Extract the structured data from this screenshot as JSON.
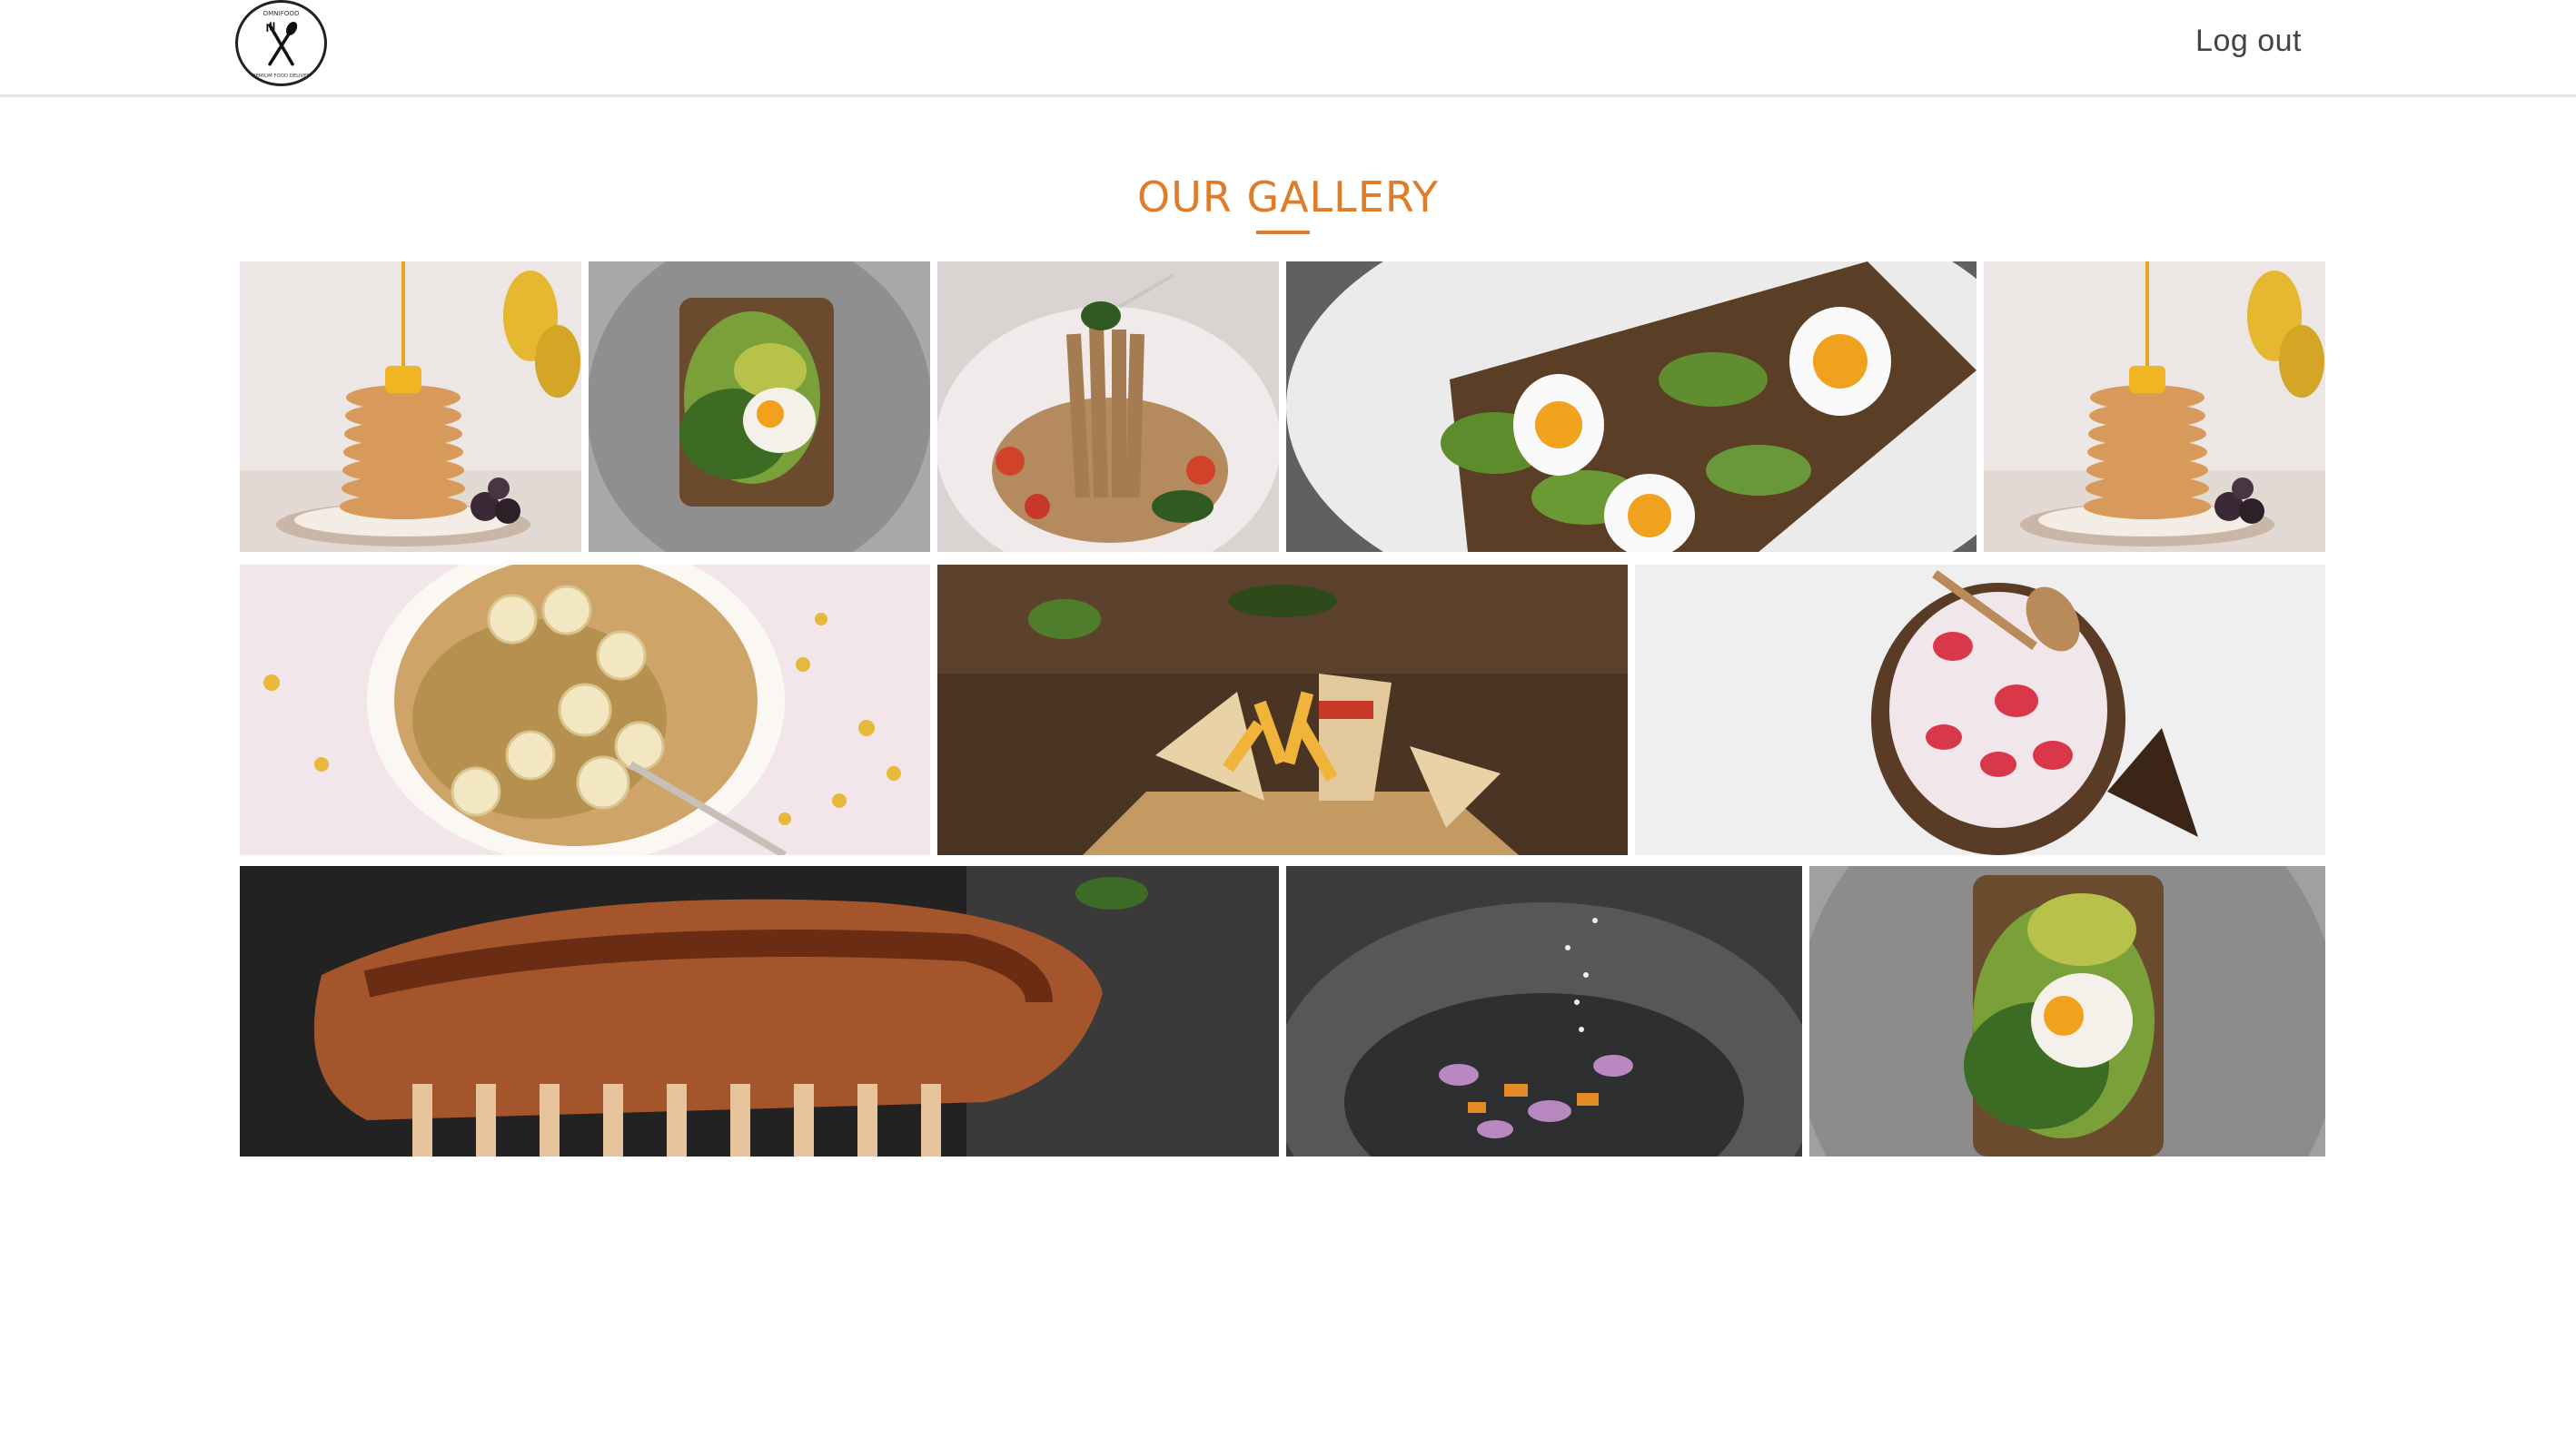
{
  "header": {
    "logo_text": "OMNIFOOD",
    "logo_subtext": "PREMIUM FOOD DELIVERY",
    "logout_label": "Log out"
  },
  "gallery": {
    "title": "OUR GALLERY",
    "accent_color": "#e07b27",
    "images": [
      {
        "name": "gallery-image-pancakes"
      },
      {
        "name": "gallery-image-avocado-toast-egg"
      },
      {
        "name": "gallery-image-spaghetti"
      },
      {
        "name": "gallery-image-avocado-eggs"
      },
      {
        "name": "gallery-image-pancakes-2"
      },
      {
        "name": "gallery-image-banana-oatmeal"
      },
      {
        "name": "gallery-image-club-sandwich"
      },
      {
        "name": "gallery-image-coconut-smoothie"
      },
      {
        "name": "gallery-image-grilled-ribs"
      },
      {
        "name": "gallery-image-spice-bowl"
      },
      {
        "name": "gallery-image-avocado-toast-egg-2"
      }
    ]
  }
}
